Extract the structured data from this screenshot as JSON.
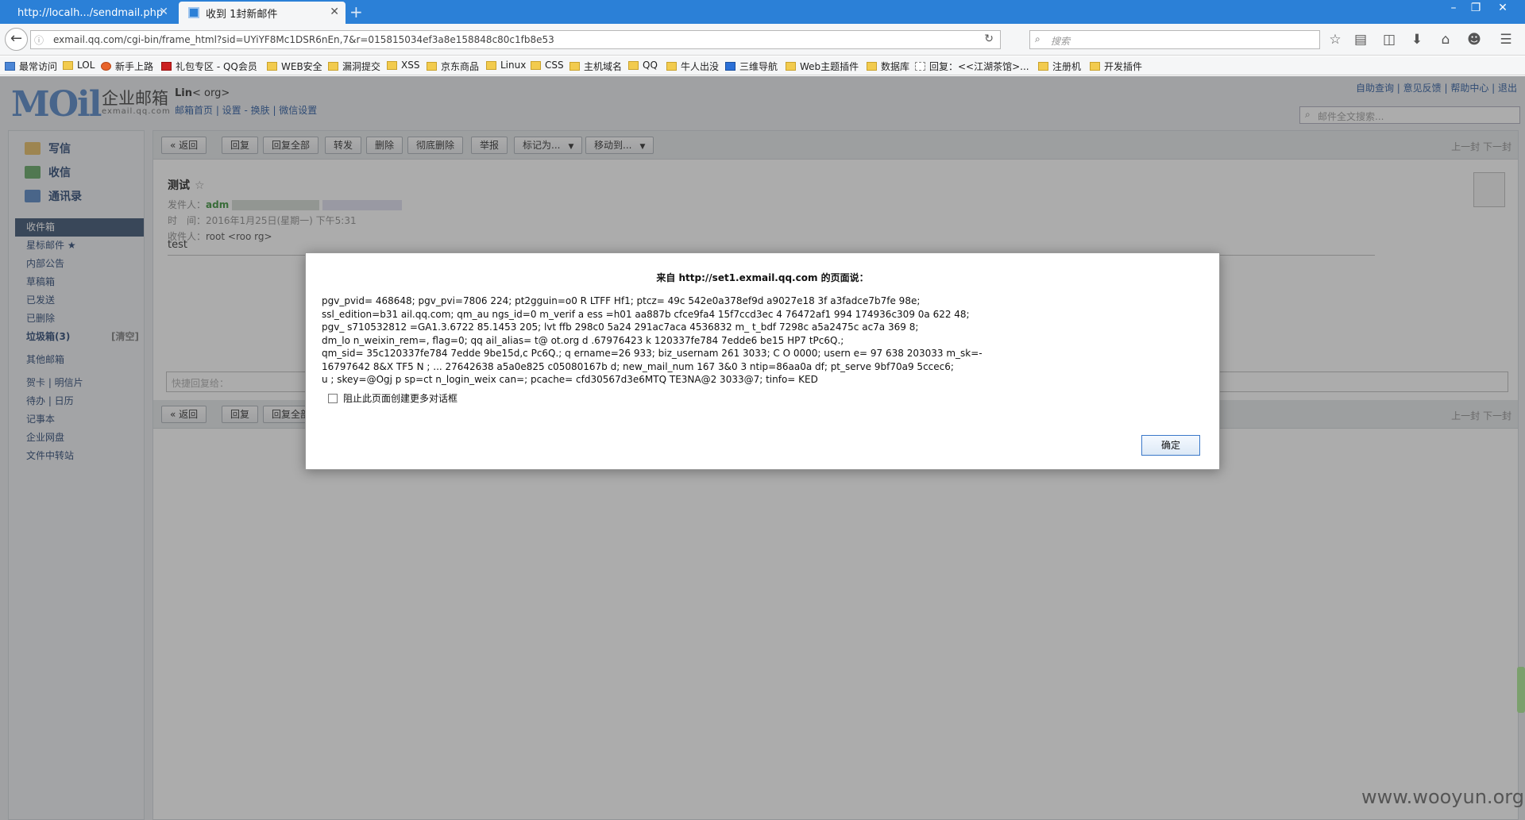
{
  "browser": {
    "tabs": [
      {
        "title": "http://localh.../sendmail.php",
        "active": false
      },
      {
        "title": "收到 1封新邮件",
        "active": true
      }
    ],
    "new_tab": "+",
    "window_controls": [
      "–",
      "❐",
      "✕"
    ],
    "url": "exmail.qq.com/cgi-bin/frame_html?sid=UYiYF8Mc1DSR6nEn,7&r=015815034ef3a8e158848c80c1fb8e53",
    "search_placeholder": "搜索",
    "toolbar_icons": [
      "star-icon",
      "reading-list-icon",
      "pocket-icon",
      "download-icon",
      "home-icon",
      "chat-icon",
      "menu-icon"
    ],
    "bookmarks": [
      "最常访问",
      "LOL",
      "新手上路",
      "礼包专区 - QQ会员",
      "WEB安全",
      "漏洞提交",
      "XSS",
      "京东商品",
      "Linux",
      "CSS",
      "主机域名",
      "QQ",
      "牛人出没",
      "三维导航",
      "Web主题插件",
      "数据库",
      "回复：<<江湖茶馆>...",
      "注册机",
      "开发插件"
    ]
  },
  "mail": {
    "logo": "MOil",
    "logo_cn": "企业邮箱",
    "logo_en": "exmail.qq.com",
    "account_name": "Lin",
    "account_addr": "<                org>",
    "account_links": "邮箱首页 | 设置 - 换肤 | 微信设置",
    "top_links": "自助查询 | 意见反馈 | 帮助中心 | 退出",
    "fulltext_placeholder": "邮件全文搜索...",
    "compose": [
      "写信",
      "收信",
      "通讯录"
    ],
    "folders": [
      {
        "label": "收件箱",
        "extra": ""
      },
      {
        "label": "星标邮件 ★",
        "extra": ""
      },
      {
        "label": "内部公告",
        "extra": ""
      },
      {
        "label": "草稿箱",
        "extra": ""
      },
      {
        "label": "已发送",
        "extra": ""
      },
      {
        "label": "已删除",
        "extra": ""
      },
      {
        "label": "垃圾箱(3)",
        "extra": "[清空]"
      },
      {
        "label": "其他邮箱",
        "extra": ""
      },
      {
        "label": "贺卡 | 明信片",
        "extra": ""
      },
      {
        "label": "待办 | 日历",
        "extra": ""
      },
      {
        "label": "记事本",
        "extra": ""
      },
      {
        "label": "企业网盘",
        "extra": ""
      },
      {
        "label": "文件中转站",
        "extra": ""
      }
    ],
    "toolbar_buttons": [
      "« 返回",
      "回复",
      "回复全部",
      "转发",
      "删除",
      "彻底删除",
      "举报",
      "标记为...",
      "移动到..."
    ],
    "pager": "上一封  下一封",
    "subject": "测试",
    "star": "☆",
    "from_label": "发件人：",
    "from_value": "adm",
    "time_label": "时　间：",
    "time_value": "2016年1月25日(星期一) 下午5:31",
    "to_label": "收件人：",
    "to_value": "root <roo            rg>",
    "body": "test",
    "quick_reply_placeholder": "快捷回复给："
  },
  "dialog": {
    "title": "来自 http://set1.exmail.qq.com 的页面说：",
    "lines": [
      "pgv_pvid=   468648; pgv_pvi=7806    224; pt2gguin=o0      R   LTFF   Hf1; ptcz=   49c   542e0a378ef9d    a9027e18   3f   a3fadce7b7fe    98e;",
      "ssl_edition=b31   ail.qq.com; qm_au   ngs_id=0   m_verif  a   ess   =h01    aa887b    cfce9fa4    15f7ccd3ec   4    76472af1    994    174936c309    0a   622   48;",
      "pgv_   s710532812    =GA1.3.6722    85.1453   205;    lvt    ffb    298c0    5a24    291ac7aca    4536832    m_   t_bdf    7298c    a5a2475c    ac7a    369   8;",
      "dm_lo   n_weixin_rem=,     flag=0; qq   ail_alias=   t@   ot.org   d   .67976423   k    120337fe784    7edde6    be15    HP7   tPc6Q.;",
      "qm_sid=   35c120337fe784    7edde   9be15d,c    Pc6Q.; q   ername=26   933; biz_usernam   261    3033; C   O   0000; usern   e=   97   638   203033   m_sk=-",
      "16797642    8&X   TF5   N   ; ...   27642638    a5a0e825    c05080167b   d; new_mail_num   167   3&0   3   ntip=86aa0a   df; pt_serve   9bf70a9   5ccec6;",
      "u   ; skey=@Ogj     p   sp=ct   n_login_weix   can=; pcache=   cfd30567d3e6MTQ   TE3NA@2   3033@7; tinfo=   KED"
    ],
    "checkbox_label": "阻止此页面创建更多对话框",
    "ok_button": "确定"
  },
  "watermark": "www.wooyun.org"
}
